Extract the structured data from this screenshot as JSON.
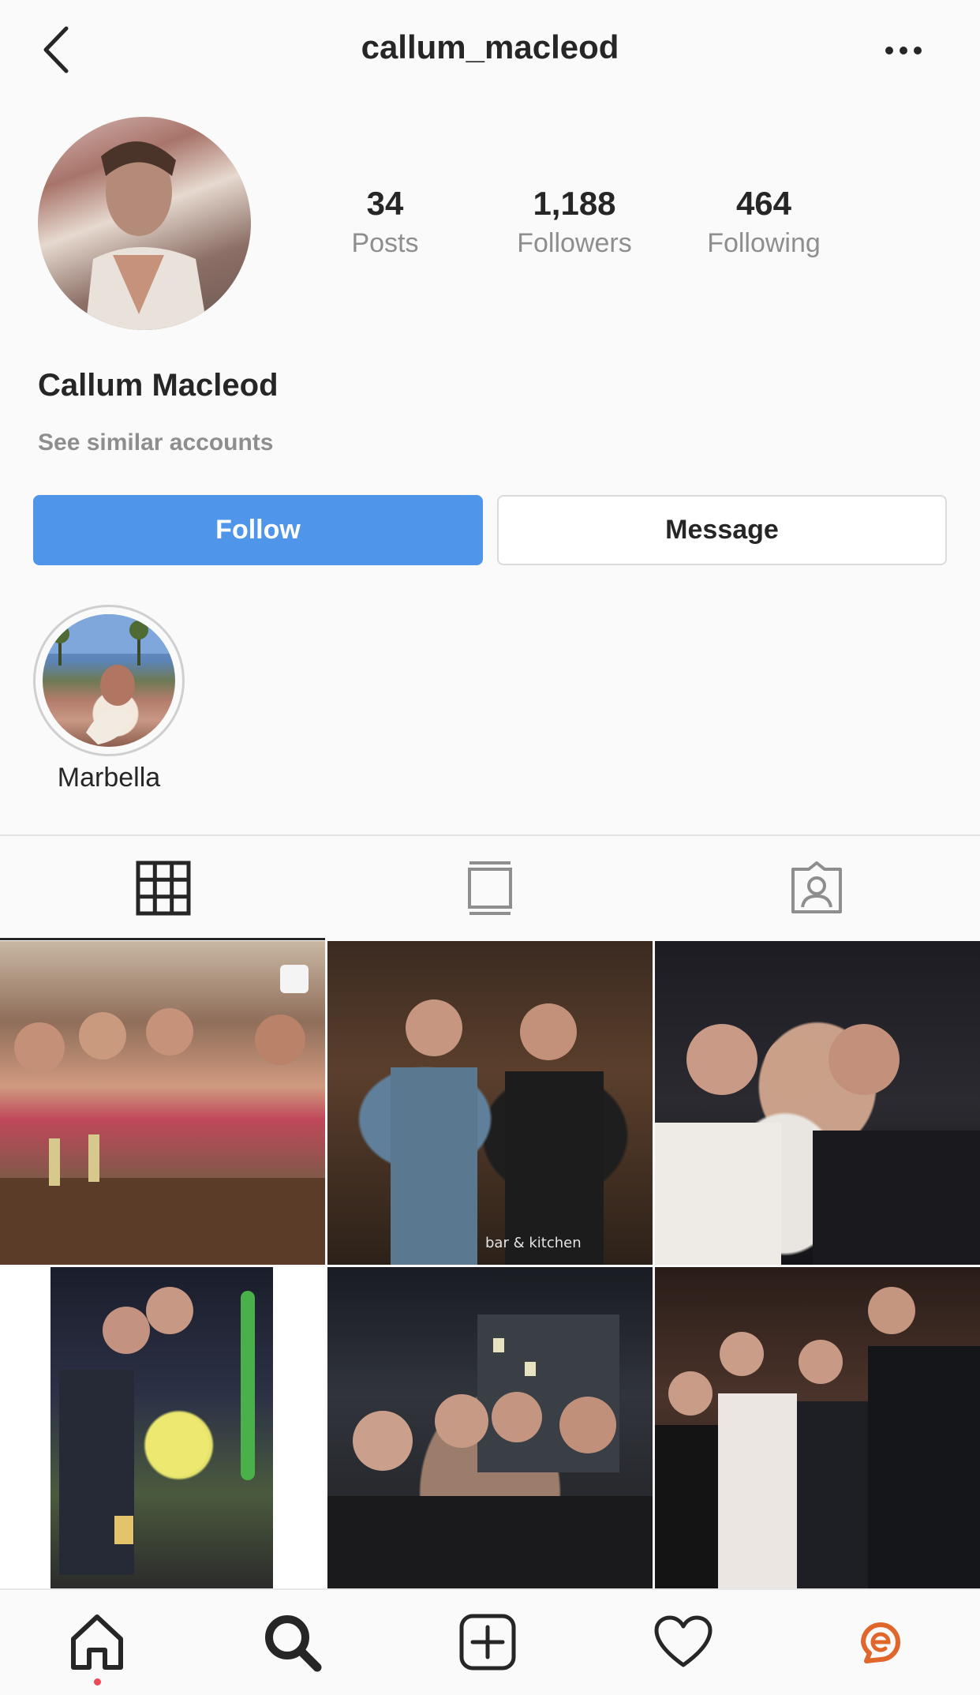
{
  "header": {
    "username": "callum_macleod",
    "back_icon": "chevron-left-icon",
    "more_icon": "ellipsis-icon"
  },
  "profile": {
    "display_name": "Callum Macleod",
    "see_similar": "See similar accounts",
    "stats": {
      "posts": {
        "value": "34",
        "label": "Posts"
      },
      "followers": {
        "value": "1,188",
        "label": "Followers"
      },
      "following": {
        "value": "464",
        "label": "Following"
      }
    }
  },
  "actions": {
    "follow_label": "Follow",
    "message_label": "Message"
  },
  "highlights": [
    {
      "label": "Marbella"
    }
  ],
  "tabs": [
    {
      "icon": "grid-icon",
      "active": true
    },
    {
      "icon": "feed-icon",
      "active": false
    },
    {
      "icon": "tagged-icon",
      "active": false
    }
  ],
  "posts": [
    {
      "caption": ""
    },
    {
      "caption": "bar & kitchen"
    },
    {
      "caption": ""
    },
    {
      "caption": ""
    },
    {
      "caption": ""
    },
    {
      "caption": ""
    }
  ],
  "bottom_nav": [
    {
      "icon": "home-icon",
      "active": true
    },
    {
      "icon": "search-icon",
      "active": false
    },
    {
      "icon": "add-post-icon",
      "active": false
    },
    {
      "icon": "heart-icon",
      "active": false
    },
    {
      "icon": "profile-icon",
      "active": false
    }
  ],
  "colors": {
    "follow_button": "#4f95e9",
    "text_primary": "#262626",
    "text_secondary": "#8e8e8e",
    "notification_dot": "#ed4956",
    "profile_logo": "#e0662c"
  }
}
